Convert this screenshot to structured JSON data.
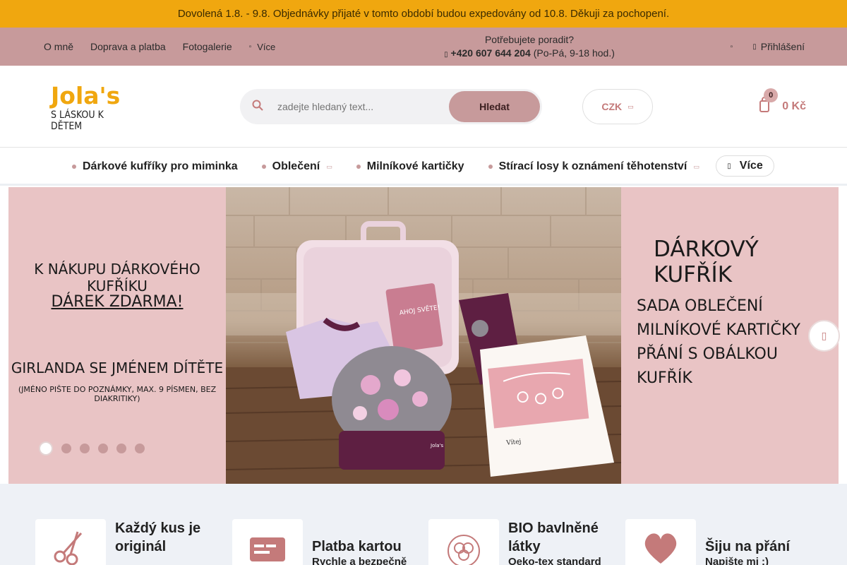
{
  "notice": {
    "text": "Dovolená 1.8. - 9.8. Objednávky přijaté v tomto období budou expedovány od 10.8. Děkuji za pochopení."
  },
  "topbar": {
    "nav": [
      "O mně",
      "Doprava a platba",
      "Fotogalerie"
    ],
    "more_label": "Více",
    "help_title": "Potřebujete poradit?",
    "help_phone": "+420 607 644 204",
    "help_hours": "(Po-Pá, 9-18 hod.)",
    "login_label": "Přihlášení"
  },
  "header": {
    "logo_brand": "Jola's",
    "logo_tagline": "S LÁSKOU K DĚTEM",
    "search_placeholder": "zadejte hledaný text...",
    "search_button": "Hledat",
    "currency": "CZK",
    "cart_count": "0",
    "cart_total": "0 Kč"
  },
  "categories": {
    "items": [
      {
        "label": "Dárkové kufříky pro miminka",
        "has_submenu": false
      },
      {
        "label": "Oblečení",
        "has_submenu": true
      },
      {
        "label": "Milníkové kartičky",
        "has_submenu": false
      },
      {
        "label": "Stírací losy k oznámení těhotenství",
        "has_submenu": true
      }
    ],
    "more_label": "Více"
  },
  "banner": {
    "left_line1": "K NÁKUPU DÁRKOVÉHO KUFŘÍKU",
    "left_line2": "DÁREK ZDARMA!",
    "left_line3": "GIRLANDA SE JMÉNEM DÍTĚTE",
    "left_line4": "(JMÉNO PIŠTE DO POZNÁMKY, MAX. 9 PÍSMEN, BEZ DIAKRITIKY)",
    "right_title": "DÁRKOVÝ KUFŘÍK",
    "right_lines": [
      "SADA OBLEČENÍ",
      "MILNÍKOVÉ KARTIČKY",
      "PŘÁNÍ S OBÁLKOU",
      "KUFŘÍK"
    ],
    "card_text": "AHOJ SVĚTE!",
    "hat_label": "Jola's",
    "greeting_card_name": "Vítej",
    "slide_count": 6,
    "active_slide": 1
  },
  "features": [
    {
      "title": "Každý kus je originál",
      "text": "",
      "icon": "scissors-icon"
    },
    {
      "title": "Platba kartou",
      "text": "Rychle a bezpečně",
      "icon": "card-icon"
    },
    {
      "title": "BIO bavlněné látky",
      "text": "Oeko-tex standard",
      "icon": "cotton-flower-icon"
    },
    {
      "title": "Šiju na přání",
      "text": "Napište mi :)",
      "icon": "heart-icon"
    }
  ],
  "colors": {
    "notice_bg": "#f0a70f",
    "topbar_bg": "#c79a9b",
    "accent": "#c47a7a",
    "banner_bg": "#e9c4c5",
    "features_bg": "#eef1f6"
  }
}
